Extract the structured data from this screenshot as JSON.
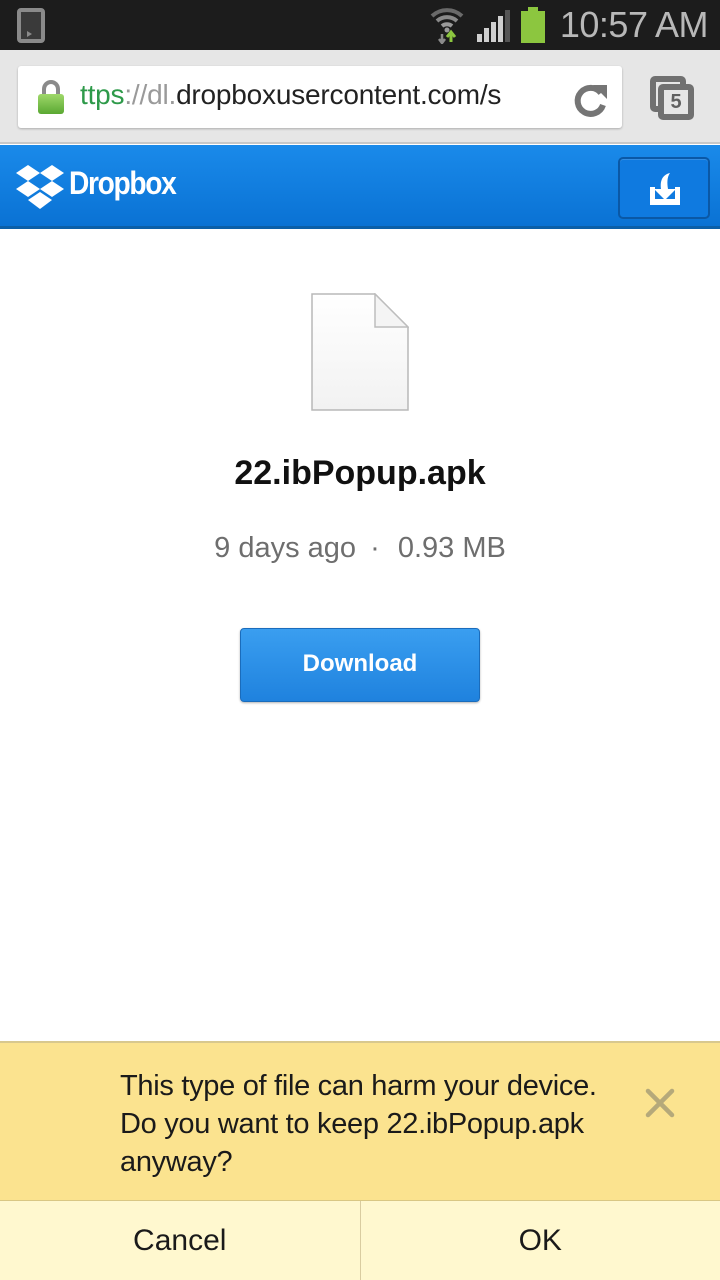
{
  "status_bar": {
    "time": "10:57 AM",
    "icons": [
      "phone-notification-icon",
      "wifi-icon",
      "signal-icon",
      "battery-icon"
    ],
    "battery_color": "#8cc63f"
  },
  "browser": {
    "url": {
      "scheme": "ttps",
      "separator": "://dl.",
      "host": "dropboxusercontent.com/s"
    },
    "tab_count": "5",
    "secure_color": "#2e9a4a"
  },
  "header": {
    "brand": "Dropbox",
    "brand_color": "#0a72d4"
  },
  "file": {
    "name": "22.ibPopup.apk",
    "modified": "9 days ago",
    "separator": "·",
    "size": "0.93 MB",
    "download_label": "Download"
  },
  "infobar": {
    "message": "This type of file can harm your device. Do you want to keep 22.ibPopup.apk anyway?",
    "cancel_label": "Cancel",
    "ok_label": "OK",
    "background": "#fbe38f"
  }
}
